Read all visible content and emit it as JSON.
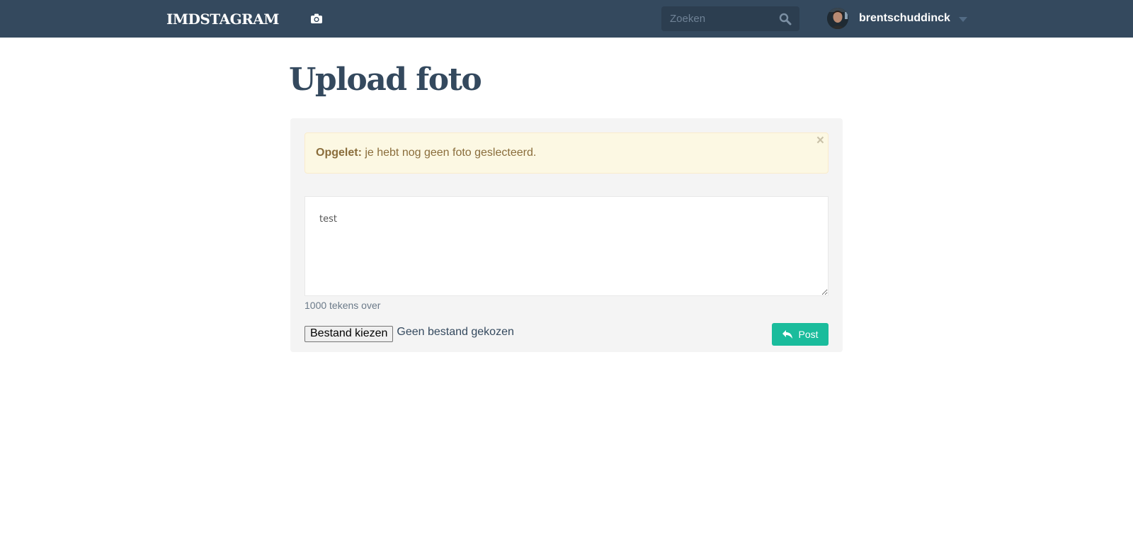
{
  "navbar": {
    "brand": "IMDSTAGRAM",
    "camera_icon": "camera-icon",
    "search": {
      "placeholder": "Zoeken",
      "value": "",
      "icon": "search-icon"
    },
    "user": {
      "username": "brentschuddinck",
      "avatar": "avatar",
      "menu_icon": "caret-down-icon"
    },
    "colors": {
      "background": "#34495e",
      "search_background": "#2c3e50"
    }
  },
  "main": {
    "title": "Upload foto",
    "alert": {
      "label": "Opgelet:",
      "message": " je hebt nog geen foto geslecteerd.",
      "close": "×"
    },
    "description": {
      "value": "test",
      "remaining": "1000 tekens over"
    },
    "file_input": {
      "button_label": "Bestand kiezen",
      "status": "Geen bestand gekozen"
    },
    "post_button": {
      "label": "Post",
      "icon": "reply-icon"
    },
    "colors": {
      "accent": "#1abc9c",
      "title": "#34495e",
      "alert_background": "#fcf8e3",
      "alert_text": "#8a6d3b"
    }
  }
}
